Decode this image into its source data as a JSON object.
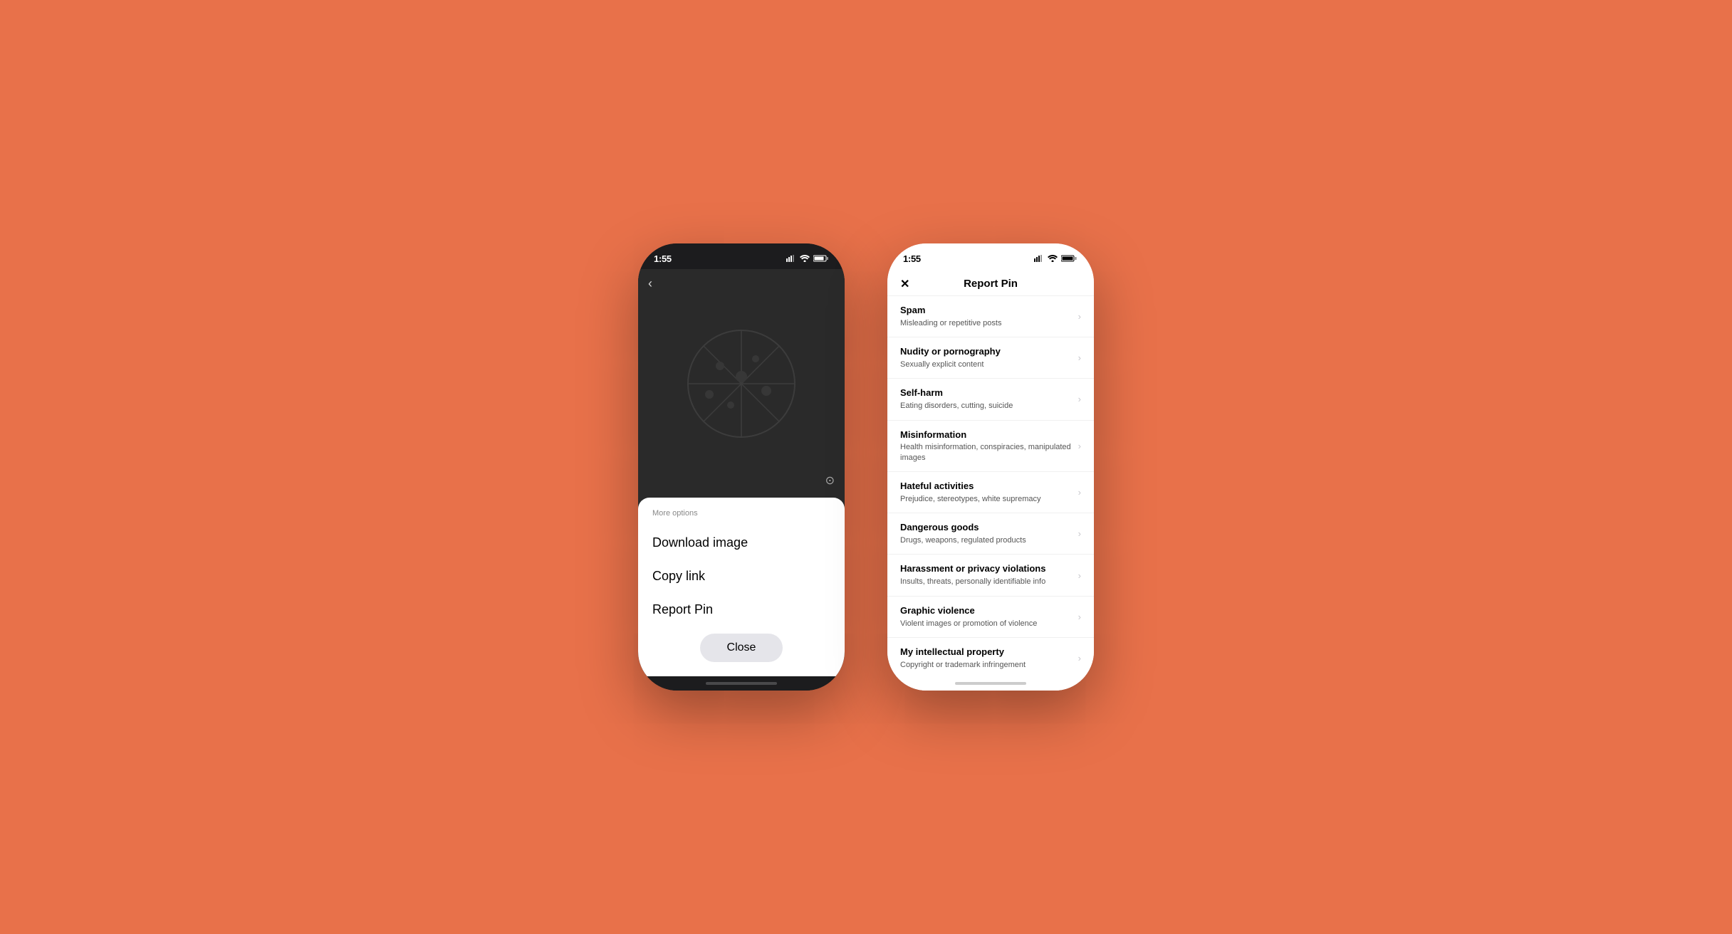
{
  "background": "#E8714A",
  "phone_left": {
    "status_time": "1:55",
    "more_options_label": "More options",
    "menu_items": [
      {
        "label": "Download image"
      },
      {
        "label": "Copy link"
      },
      {
        "label": "Report Pin"
      }
    ],
    "close_button_label": "Close"
  },
  "phone_right": {
    "status_time": "1:55",
    "page_title": "Report Pin",
    "close_icon_label": "✕",
    "report_items": [
      {
        "title": "Spam",
        "subtitle": "Misleading or repetitive posts"
      },
      {
        "title": "Nudity or pornography",
        "subtitle": "Sexually explicit content"
      },
      {
        "title": "Self-harm",
        "subtitle": "Eating disorders, cutting, suicide"
      },
      {
        "title": "Misinformation",
        "subtitle": "Health misinformation, conspiracies, manipulated images"
      },
      {
        "title": "Hateful activities",
        "subtitle": "Prejudice, stereotypes, white supremacy"
      },
      {
        "title": "Dangerous goods",
        "subtitle": "Drugs, weapons, regulated products"
      },
      {
        "title": "Harassment or privacy violations",
        "subtitle": "Insults, threats, personally identifiable info"
      },
      {
        "title": "Graphic violence",
        "subtitle": "Violent images or promotion of violence"
      },
      {
        "title": "My intellectual property",
        "subtitle": "Copyright or trademark infringement"
      }
    ]
  }
}
